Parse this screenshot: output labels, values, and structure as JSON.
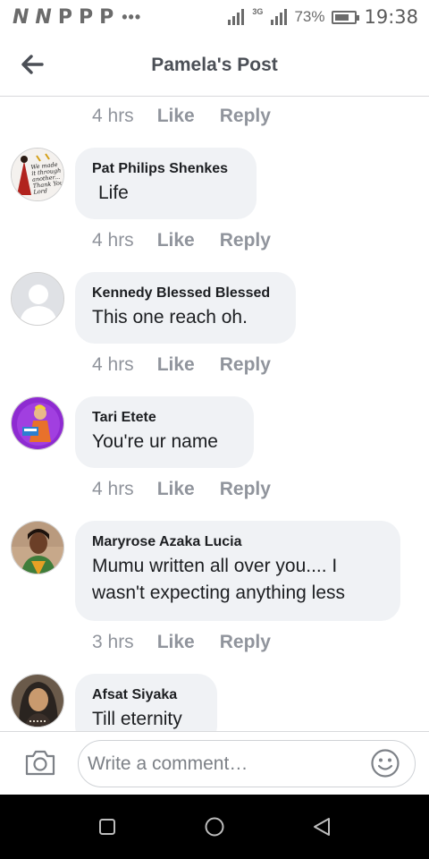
{
  "status_bar": {
    "notification_icons": [
      "N",
      "N",
      "P",
      "P",
      "P"
    ],
    "more_indicator": "•••",
    "network_label": "3G",
    "battery_percent": "73%",
    "battery_level": 0.73,
    "time": "19:38"
  },
  "header": {
    "title": "Pamela's Post",
    "back_icon": "arrow-left-icon"
  },
  "comments": [
    {
      "author": "",
      "text": "",
      "time": "4 hrs",
      "like": "Like",
      "reply": "Reply"
    },
    {
      "author": "Pat Philips Shenkes",
      "text": "Life",
      "time": "4 hrs",
      "like": "Like",
      "reply": "Reply"
    },
    {
      "author": "Kennedy Blessed Blessed",
      "text": "This one reach oh.",
      "time": "4 hrs",
      "like": "Like",
      "reply": "Reply"
    },
    {
      "author": "Tari Etete",
      "text": "You're ur name",
      "time": "4 hrs",
      "like": "Like",
      "reply": "Reply"
    },
    {
      "author": "Maryrose Azaka Lucia",
      "text": "Mumu written all over you.... I wasn't expecting anything less",
      "time": "3 hrs",
      "like": "Like",
      "reply": "Reply"
    },
    {
      "author": "Afsat Siyaka",
      "text": "Till eternity"
    }
  ],
  "avatar_badge_text": "We made it through another... Thank You Lord",
  "composer": {
    "placeholder": "Write a comment…",
    "camera_icon": "camera-icon",
    "emoji_icon": "smiley-icon"
  },
  "nav_bar": {
    "buttons": [
      "recent-apps-icon",
      "home-icon",
      "back-triangle-icon"
    ]
  },
  "colors": {
    "bubble": "#f0f2f5",
    "meta_text": "#90949c",
    "header_title": "#4b4f56",
    "nav_bar": "#000000"
  }
}
